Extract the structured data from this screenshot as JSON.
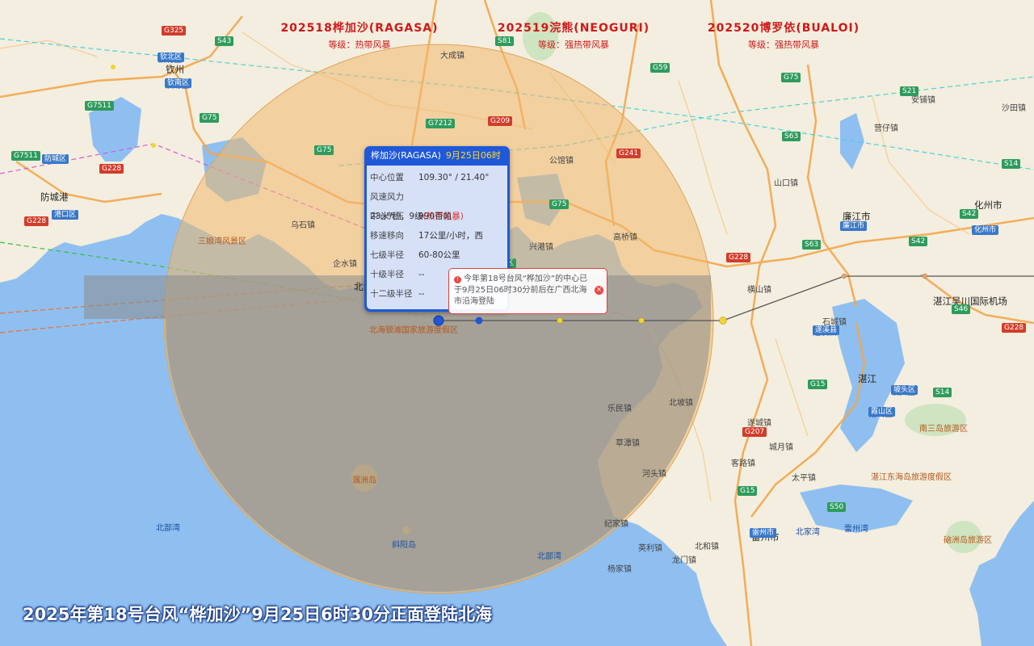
{
  "storms": [
    {
      "name": "202518桦加沙(RAGASA)",
      "level": "等级：热带风暴",
      "color": "#d01818"
    },
    {
      "name": "202519浣熊(NEOGURI)",
      "level": "等级：强热带风暴",
      "color": "#d01818"
    },
    {
      "name": "202520博罗依(BUALOI)",
      "level": "等级：强热带风暴",
      "color": "#d01818"
    }
  ],
  "title_overlay": "2025年第18号台风“桦加沙”9月25日6时30分正面登陆北海",
  "popup": {
    "name": "桦加沙(RAGASA)",
    "time": "9月25日06时",
    "rows": [
      {
        "k": "中心位置",
        "v": "109.30° / 21.40°"
      },
      {
        "k": "风速风力",
        "v": "23米/秒，9级",
        "v_red": "(热带风暴)"
      },
      {
        "k": "中心气压",
        "v": "990百帕"
      },
      {
        "k": "移速移向",
        "v": "17公里/小时，西"
      },
      {
        "k": "七级半径",
        "v": "60-80公里"
      },
      {
        "k": "十级半径",
        "v": "--"
      },
      {
        "k": "十二级半径",
        "v": "--"
      }
    ]
  },
  "notice": {
    "text": "今年第18号台风“桦加沙”的中心已于9月25日06时30分前后在广西北海市沿海登陆"
  },
  "colors": {
    "sea": "#8fbff0",
    "land": "#f3eedf",
    "wind7": "#f0b86c",
    "track": "#555555",
    "point": "#f2d431",
    "center": "#2156d6"
  },
  "places": [
    {
      "t": "钦州",
      "cls": "city"
    },
    {
      "t": "防城港",
      "cls": "city"
    },
    {
      "t": "北海",
      "cls": "city"
    },
    {
      "t": "廉江市",
      "cls": "city"
    },
    {
      "t": "湛江",
      "cls": "city"
    },
    {
      "t": "化州市",
      "cls": "city"
    },
    {
      "t": "雷州市",
      "cls": "city"
    },
    {
      "t": "北部湾",
      "cls": "blue"
    },
    {
      "t": "三娘湾风景区",
      "cls": "scenic"
    },
    {
      "t": "北海银滩国家旅游度假区",
      "cls": "scenic"
    },
    {
      "t": "南三岛旅游区",
      "cls": "scenic"
    },
    {
      "t": "湛江东海岛旅游度假区",
      "cls": "scenic"
    },
    {
      "t": "硇洲岛旅游区",
      "cls": "scenic"
    },
    {
      "t": "湛江吴川国际机场",
      "cls": "city"
    },
    {
      "t": "涠洲岛",
      "cls": "scenic"
    },
    {
      "t": "斜阳岛",
      "cls": "blue"
    },
    {
      "t": "港口区",
      "cls": "blue"
    },
    {
      "t": "钦北区",
      "cls": "blue"
    },
    {
      "t": "钦南区",
      "cls": "blue"
    },
    {
      "t": "遂溪县",
      "cls": "blue"
    },
    {
      "t": "坡头区",
      "cls": "blue"
    },
    {
      "t": "霞山区",
      "cls": "blue"
    },
    {
      "t": "北部湾",
      "cls": "blue"
    },
    {
      "t": "雷州湾",
      "cls": "blue"
    },
    {
      "t": "北家湾",
      "cls": "blue"
    },
    {
      "t": "安铺镇",
      "cls": ""
    },
    {
      "t": "营仔镇",
      "cls": ""
    },
    {
      "t": "乌石镇",
      "cls": ""
    },
    {
      "t": "企水镇",
      "cls": ""
    },
    {
      "t": "北坡镇",
      "cls": ""
    },
    {
      "t": "河头镇",
      "cls": ""
    },
    {
      "t": "纪家镇",
      "cls": ""
    },
    {
      "t": "杨家镇",
      "cls": ""
    },
    {
      "t": "英利镇",
      "cls": ""
    },
    {
      "t": "北和镇",
      "cls": ""
    },
    {
      "t": "龙门镇",
      "cls": ""
    },
    {
      "t": "乐民镇",
      "cls": ""
    },
    {
      "t": "草潭镇",
      "cls": ""
    },
    {
      "t": "遂城镇",
      "cls": ""
    },
    {
      "t": "城月镇",
      "cls": ""
    },
    {
      "t": "客路镇",
      "cls": ""
    },
    {
      "t": "太平镇",
      "cls": ""
    },
    {
      "t": "公馆镇",
      "cls": ""
    },
    {
      "t": "兴港镇",
      "cls": ""
    },
    {
      "t": "高桥镇",
      "cls": ""
    },
    {
      "t": "山口镇",
      "cls": ""
    },
    {
      "t": "石城镇",
      "cls": ""
    },
    {
      "t": "横山镇",
      "cls": ""
    },
    {
      "t": "大成镇",
      "cls": ""
    },
    {
      "t": "沙田镇",
      "cls": ""
    }
  ]
}
